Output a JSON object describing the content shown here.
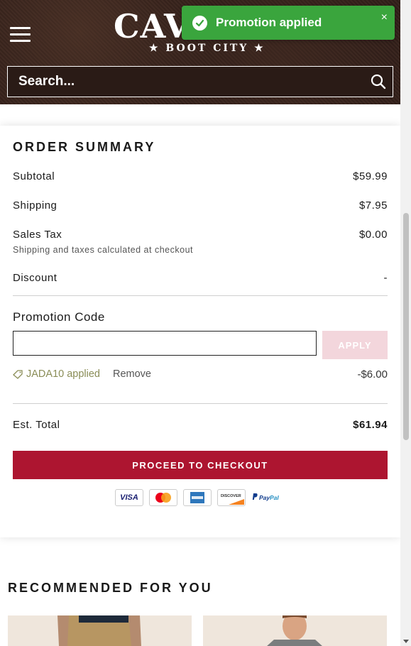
{
  "header": {
    "logo_main": "CAVENDERS",
    "logo_sub": "★ BOOT CITY ★",
    "search_placeholder": "Search..."
  },
  "toast": {
    "message": "Promotion applied",
    "close": "×",
    "color": "#3aa53d"
  },
  "order_summary": {
    "title": "ORDER SUMMARY",
    "subtotal_label": "Subtotal",
    "subtotal_value": "$59.99",
    "shipping_label": "Shipping",
    "shipping_value": "$7.95",
    "tax_label": "Sales Tax",
    "tax_value": "$0.00",
    "tax_note": "Shipping and taxes calculated at checkout",
    "discount_label": "Discount",
    "discount_value": "-",
    "promo_label": "Promotion Code",
    "promo_input_value": "",
    "apply_label": "APPLY",
    "applied_code": "JADA10 applied",
    "remove_label": "Remove",
    "applied_amount": "-$6.00",
    "total_label": "Est. Total",
    "total_value": "$61.94",
    "checkout_label": "PROCEED TO CHECKOUT",
    "checkout_color": "#ad1530",
    "payments": [
      "VISA",
      "Mastercard",
      "American Express",
      "DISCOVER",
      "PayPal"
    ]
  },
  "recommended": {
    "title": "RECOMMENDED FOR YOU"
  }
}
